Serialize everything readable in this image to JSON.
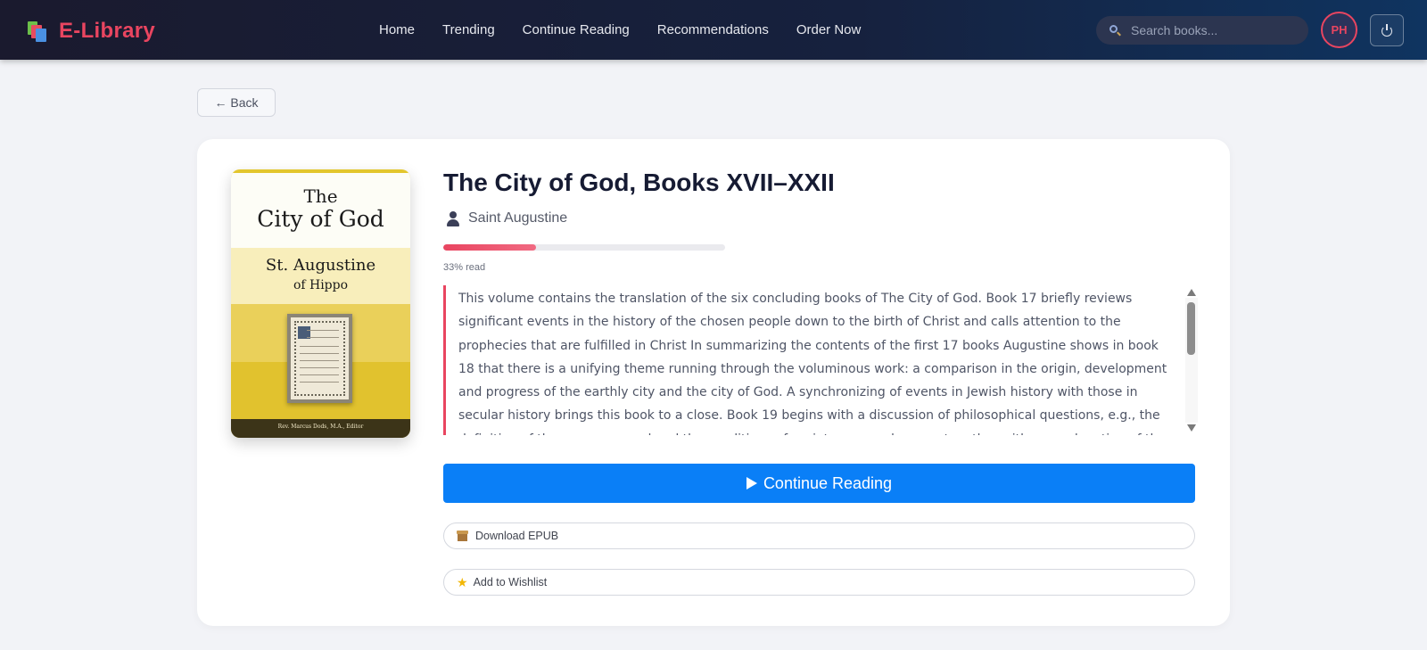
{
  "app": {
    "name": "E-Library"
  },
  "nav": {
    "links": [
      "Home",
      "Trending",
      "Continue Reading",
      "Recommendations",
      "Order Now"
    ]
  },
  "search": {
    "placeholder": "Search books..."
  },
  "user": {
    "initials": "PH"
  },
  "back": {
    "label": "← Back"
  },
  "book": {
    "title": "The City of God, Books XVII–XXII",
    "author": "Saint Augustine",
    "progress_percent": 33,
    "progress_label": "33% read",
    "description": "This volume contains the translation of the six concluding books of The City of God. Book 17 briefly reviews significant events in the history of the chosen people down to the birth of Christ and calls attention to the prophecies that are fulfilled in Christ In summarizing the contents of the first 17 books Augustine shows in book 18 that there is a unifying theme running through the voluminous work: a comparison in the origin, development and progress of the earthly city and the city of God. A synchronizing of events in Jewish history with those in secular history brings this book to a close. Book 19 begins with a discussion of philosophical questions, e.g., the definition of the supreme good and the conditions of society, war and peace, together with an explanation of the difference between the earthly city and God's city.",
    "cover": {
      "the": "The",
      "title_line": "City of God",
      "author_line1": "St. Augustine",
      "author_line2": "of Hippo",
      "editor": "Rev. Marcus Dods, M.A., Editor"
    }
  },
  "actions": {
    "continue_label": "Continue Reading",
    "download_label": "Download EPUB",
    "wishlist_label": "Add to Wishlist"
  },
  "colors": {
    "brand": "#e94560",
    "primary_button": "#0a7ff7",
    "nav_bg": "#1a1a2e"
  },
  "icons": [
    "books-logo-icon",
    "search-icon",
    "power-icon",
    "user-icon",
    "play-icon",
    "package-icon",
    "star-icon"
  ]
}
